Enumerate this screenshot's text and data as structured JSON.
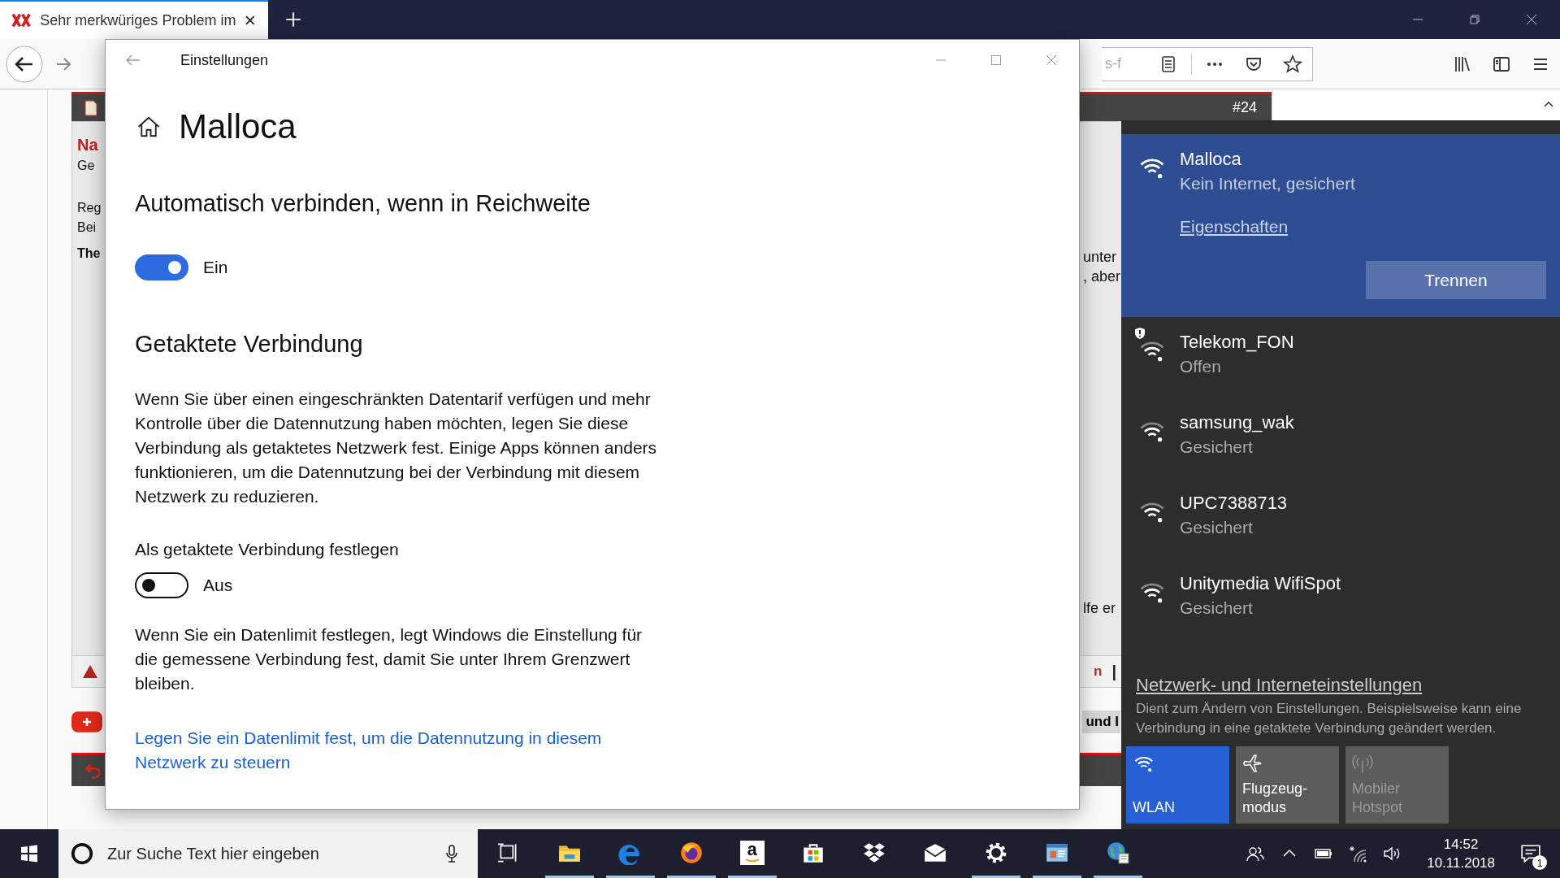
{
  "browser": {
    "tab": {
      "title": "Sehr merkwüriges Problem im",
      "selected": true
    },
    "url_fragment": "s-f"
  },
  "page": {
    "post_number": "#24",
    "left": [
      {
        "text": "Na",
        "kind": "title"
      },
      {
        "text": "Ge",
        "kind": "text"
      },
      {
        "text": "Reg",
        "kind": "gap"
      },
      {
        "text": "Bei",
        "kind": "text"
      },
      {
        "text": "The",
        "kind": "bold"
      }
    ],
    "right": [
      {
        "text": "unter",
        "kind": "gap"
      },
      {
        "text": ", aber",
        "kind": "text"
      }
    ],
    "right_lower": "lfe er",
    "footer_link": "n",
    "footer_separator": "|",
    "tag_fragment": "und I"
  },
  "settings": {
    "title": "Einstellungen",
    "network": "Malloca",
    "auto_heading": "Automatisch verbinden, wenn in Reichweite",
    "auto_toggle": {
      "on": true,
      "label": "Ein"
    },
    "metered_heading": "Getaktete Verbindung",
    "metered_text": "Wenn Sie über einen eingeschränkten Datentarif verfügen und mehr Kontrolle über die Datennutzung haben möchten, legen Sie diese Verbindung als getaktetes Netzwerk fest. Einige Apps können anders funktionieren, um die Datennutzung bei der Verbindung mit diesem Netzwerk zu reduzieren.",
    "metered_label": "Als getaktete Verbindung festlegen",
    "metered_toggle": {
      "on": false,
      "label": "Aus"
    },
    "limit_text": "Wenn Sie ein Datenlimit festlegen, legt Windows die Einstellung für die gemessene Verbindung fest, damit Sie unter Ihrem Grenzwert bleiben.",
    "limit_link": "Legen Sie ein Datenlimit fest, um die Datennutzung in diesem Netzwerk zu steuern"
  },
  "flyout": {
    "connected": {
      "name": "Malloca",
      "status": "Kein Internet, gesichert",
      "properties_link": "Eigenschaften",
      "disconnect_button": "Trennen"
    },
    "networks": [
      {
        "name": "Telekom_FON",
        "status": "Offen",
        "open": true
      },
      {
        "name": "samsung_wak",
        "status": "Gesichert",
        "open": false
      },
      {
        "name": "UPC7388713",
        "status": "Gesichert",
        "open": false
      },
      {
        "name": "Unitymedia WifiSpot",
        "status": "Gesichert",
        "open": false
      }
    ],
    "settings_link": "Netzwerk- und Interneteinstellungen",
    "settings_hint": "Dient zum Ändern von Einstellungen. Beispielsweise kann eine Verbindung in eine getaktete Verbindung geändert werden.",
    "tiles": [
      {
        "label": "WLAN",
        "kind": "wifi",
        "on": true,
        "disabled": false
      },
      {
        "label": "Flugzeug-modus",
        "kind": "airplane",
        "on": false,
        "disabled": false
      },
      {
        "label": "Mobiler Hotspot",
        "kind": "hotspot",
        "on": false,
        "disabled": true
      }
    ]
  },
  "taskbar": {
    "search_placeholder": "Zur Suche Text hier eingeben",
    "apps": [
      {
        "kind": "taskview",
        "running": false
      },
      {
        "kind": "explorer",
        "running": true
      },
      {
        "kind": "edge",
        "running": true
      },
      {
        "kind": "firefox",
        "running": true
      },
      {
        "kind": "amazon",
        "running": true,
        "glyph": "a"
      },
      {
        "kind": "store",
        "running": false
      },
      {
        "kind": "dropbox",
        "running": false
      },
      {
        "kind": "mail",
        "running": false
      },
      {
        "kind": "settings",
        "running": true
      },
      {
        "kind": "app",
        "running": true
      },
      {
        "kind": "globe",
        "running": true
      }
    ],
    "time": "14:52",
    "date": "10.11.2018",
    "notifications": "1"
  }
}
